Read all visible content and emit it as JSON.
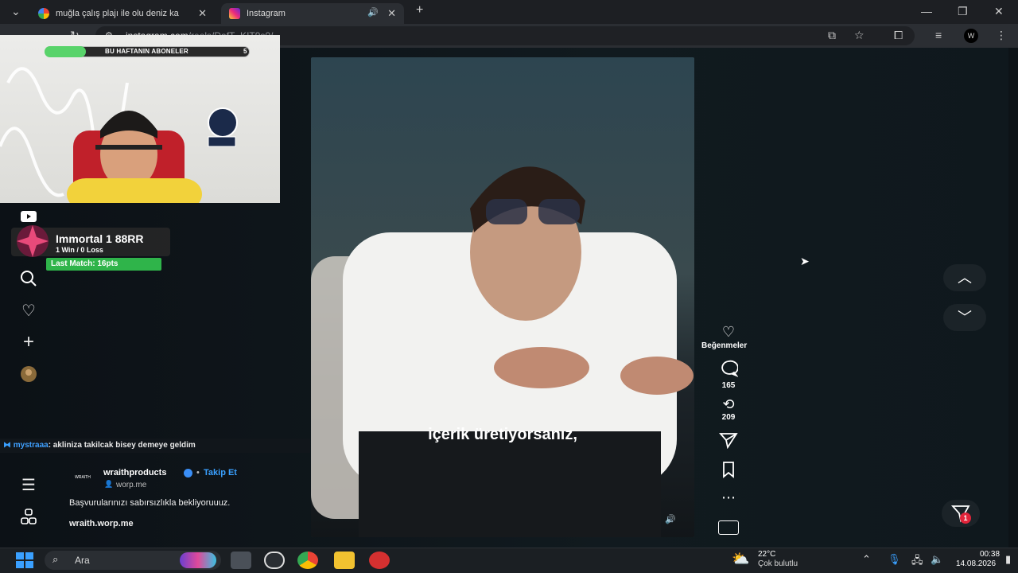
{
  "browser": {
    "tabs": [
      {
        "label": "muğla çalış plajı ile olu deniz ka",
        "active": false
      },
      {
        "label": "Instagram",
        "active": true
      }
    ],
    "url_host": "instagram.com",
    "url_path": "/reels/DafT_KIT9s0/"
  },
  "stream_overlay": {
    "subscriber_goal_label": "BU HAFTANIN ABONELER",
    "subscriber_goal_count": "5",
    "subscriber_goal_progress": 0.2,
    "rank_title": "Immortal 1  88RR",
    "rank_record": "1 Win / 0 Loss",
    "rank_last_match": "Last Match: 16pts",
    "chat_user": "mystraaa",
    "chat_message": ": akliniza takilcak bisey demeye geldim"
  },
  "reel": {
    "caption": "içerik üretiyorsanız,",
    "author": "wraithproducts",
    "follow_label": "Takip Et",
    "site": "worp.me",
    "description": "Başvurularınızı sabırsızlıkla bekliyoruuuz.",
    "link": "wraith.worp.me",
    "brand_logo_text": "WRAITH",
    "actions": {
      "likes_label": "Beğenmeler",
      "comments": "165",
      "reposts": "209"
    },
    "messages_badge": "1"
  },
  "taskbar": {
    "search_placeholder": "Ara",
    "weather_temp": "22°C",
    "weather_desc": "Çok bulutlu",
    "time": "00:38",
    "date": "14.08.2026"
  },
  "colors": {
    "accent_link": "#3aa0ff",
    "rank_green": "#2fb44a",
    "sub_progress": "#58d36a"
  }
}
